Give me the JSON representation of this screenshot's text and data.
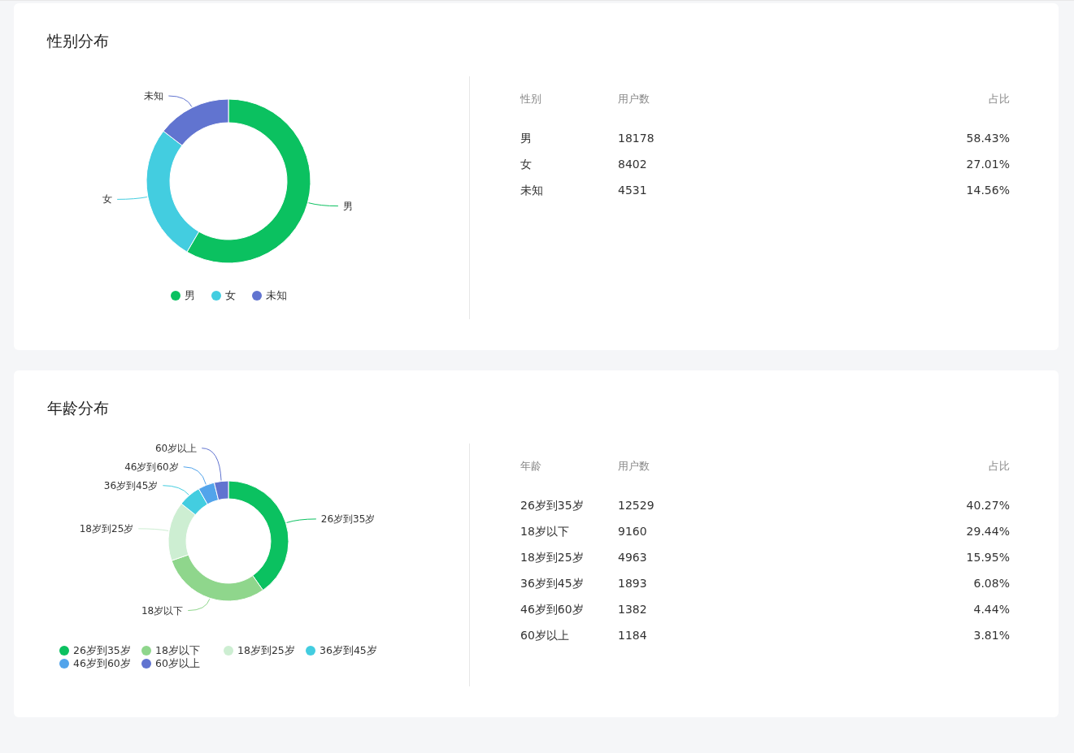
{
  "sections": [
    {
      "title": "性别分布",
      "chart_data": {
        "type": "donut",
        "categories": [
          "男",
          "女",
          "未知"
        ],
        "values": [
          58.43,
          27.01,
          14.56
        ]
      },
      "legend": [
        {
          "label": "男",
          "color": "#0bc160"
        },
        {
          "label": "女",
          "color": "#43cde0"
        },
        {
          "label": "未知",
          "color": "#6174d0"
        }
      ],
      "table": {
        "columns": [
          "性别",
          "用户数",
          "占比"
        ],
        "rows": [
          [
            "男",
            "18178",
            "58.43%"
          ],
          [
            "女",
            "8402",
            "27.01%"
          ],
          [
            "未知",
            "4531",
            "14.56%"
          ]
        ]
      }
    },
    {
      "title": "年龄分布",
      "chart_data": {
        "type": "donut",
        "categories": [
          "26岁到35岁",
          "18岁以下",
          "18岁到25岁",
          "36岁到45岁",
          "46岁到60岁",
          "60岁以上"
        ],
        "values": [
          40.27,
          29.44,
          15.95,
          6.08,
          4.44,
          3.81
        ]
      },
      "legend": [
        {
          "label": "26岁到35岁",
          "color": "#0bc160"
        },
        {
          "label": "18岁以下",
          "color": "#8fd68c"
        },
        {
          "label": "18岁到25岁",
          "color": "#cdeed2"
        },
        {
          "label": "36岁到45岁",
          "color": "#43cde0"
        },
        {
          "label": "46岁到60岁",
          "color": "#52a4eb"
        },
        {
          "label": "60岁以上",
          "color": "#6174d0"
        }
      ],
      "table": {
        "columns": [
          "年龄",
          "用户数",
          "占比"
        ],
        "rows": [
          [
            "26岁到35岁",
            "12529",
            "40.27%"
          ],
          [
            "18岁以下",
            "9160",
            "29.44%"
          ],
          [
            "18岁到25岁",
            "4963",
            "15.95%"
          ],
          [
            "36岁到45岁",
            "1893",
            "6.08%"
          ],
          [
            "46岁到60岁",
            "1382",
            "4.44%"
          ],
          [
            "60岁以上",
            "1184",
            "3.81%"
          ]
        ]
      }
    }
  ]
}
